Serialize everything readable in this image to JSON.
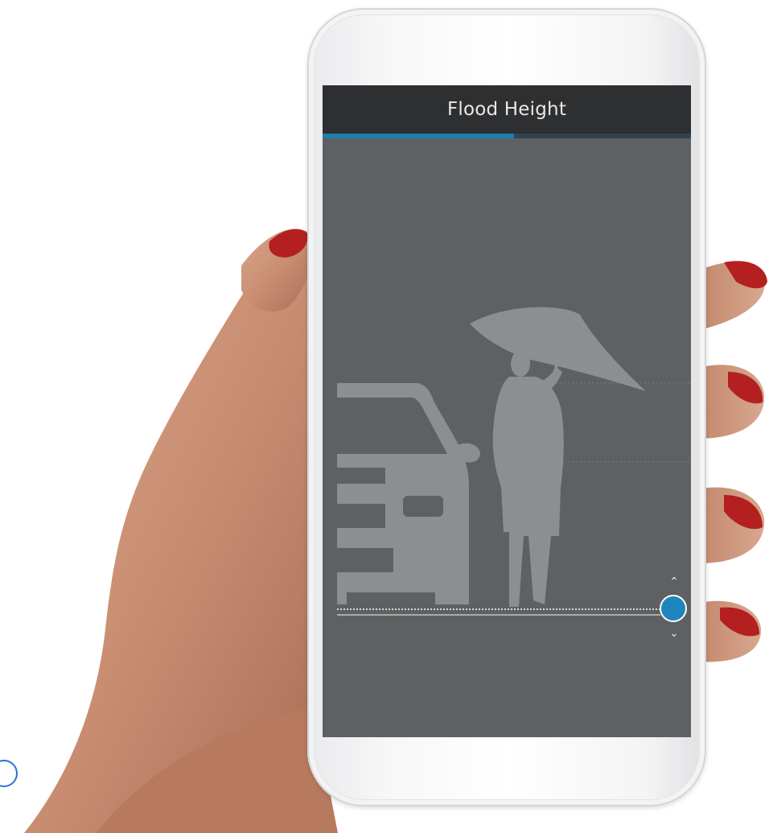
{
  "screen": {
    "title": "Flood Height",
    "progress_fraction": 0.52
  },
  "slider": {
    "up_arrow": "⌃",
    "down_arrow": "⌄",
    "accent_color": "#1f86bd"
  },
  "colors": {
    "header_bg": "#2e2f31",
    "screen_bg": "#5f6062",
    "silhouette": "#8d8e90",
    "progress_fill": "#1f7fae",
    "progress_track": "#2f4452"
  }
}
